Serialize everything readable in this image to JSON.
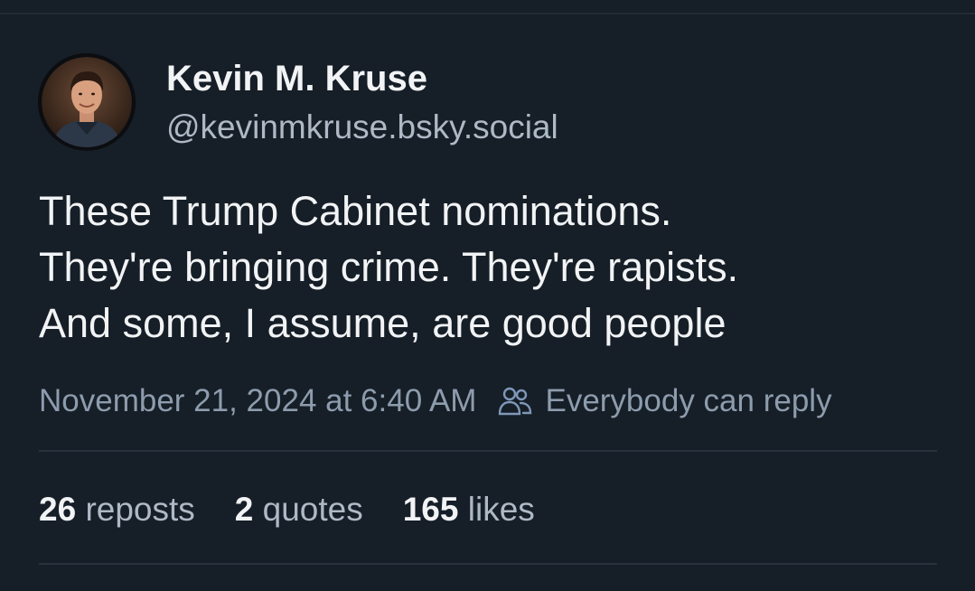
{
  "author": {
    "display_name": "Kevin M. Kruse",
    "handle": "@kevinmkruse.bsky.social",
    "avatar_icon": "profile-photo"
  },
  "post": {
    "lines": [
      "These Trump Cabinet nominations.",
      "They're bringing crime. They're rapists.",
      "And some, I assume, are good people"
    ],
    "timestamp": "November 21, 2024 at 6:40 AM",
    "reply_icon": "people-icon",
    "reply_setting": "Everybody can reply"
  },
  "stats": {
    "reposts": {
      "count": "26",
      "label": "reposts"
    },
    "quotes": {
      "count": "2",
      "label": "quotes"
    },
    "likes": {
      "count": "165",
      "label": "likes"
    }
  },
  "colors": {
    "background": "#161e27",
    "primary_text": "#f1f3f5",
    "secondary_text": "#aeb9c6",
    "meta_text": "#8d9cad",
    "divider": "#27313d"
  }
}
